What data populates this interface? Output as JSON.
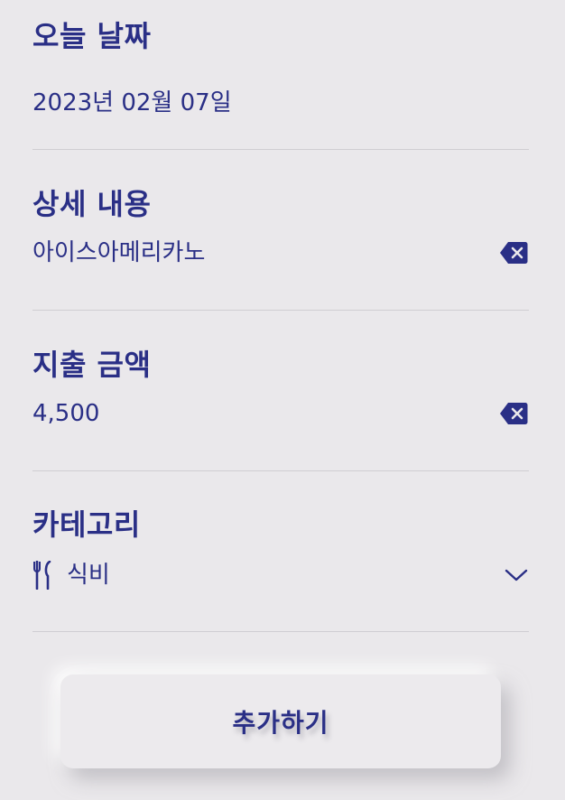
{
  "date_section": {
    "title": "오늘 날짜",
    "value": "2023년 02월 07일"
  },
  "detail_section": {
    "title": "상세 내용",
    "value": "아이스아메리카노",
    "clear_icon": "backspace-x-icon"
  },
  "amount_section": {
    "title": "지출 금액",
    "value": "4,500",
    "clear_icon": "backspace-x-icon"
  },
  "category_section": {
    "title": "카테고리",
    "selected_icon": "fork-knife-icon",
    "selected_value": "식비",
    "dropdown_icon": "chevron-down-icon"
  },
  "add_button": {
    "label": "추가하기"
  },
  "colors": {
    "background": "#EAE8EB",
    "accent": "#2A2F86",
    "divider": "#CFCDD2"
  }
}
